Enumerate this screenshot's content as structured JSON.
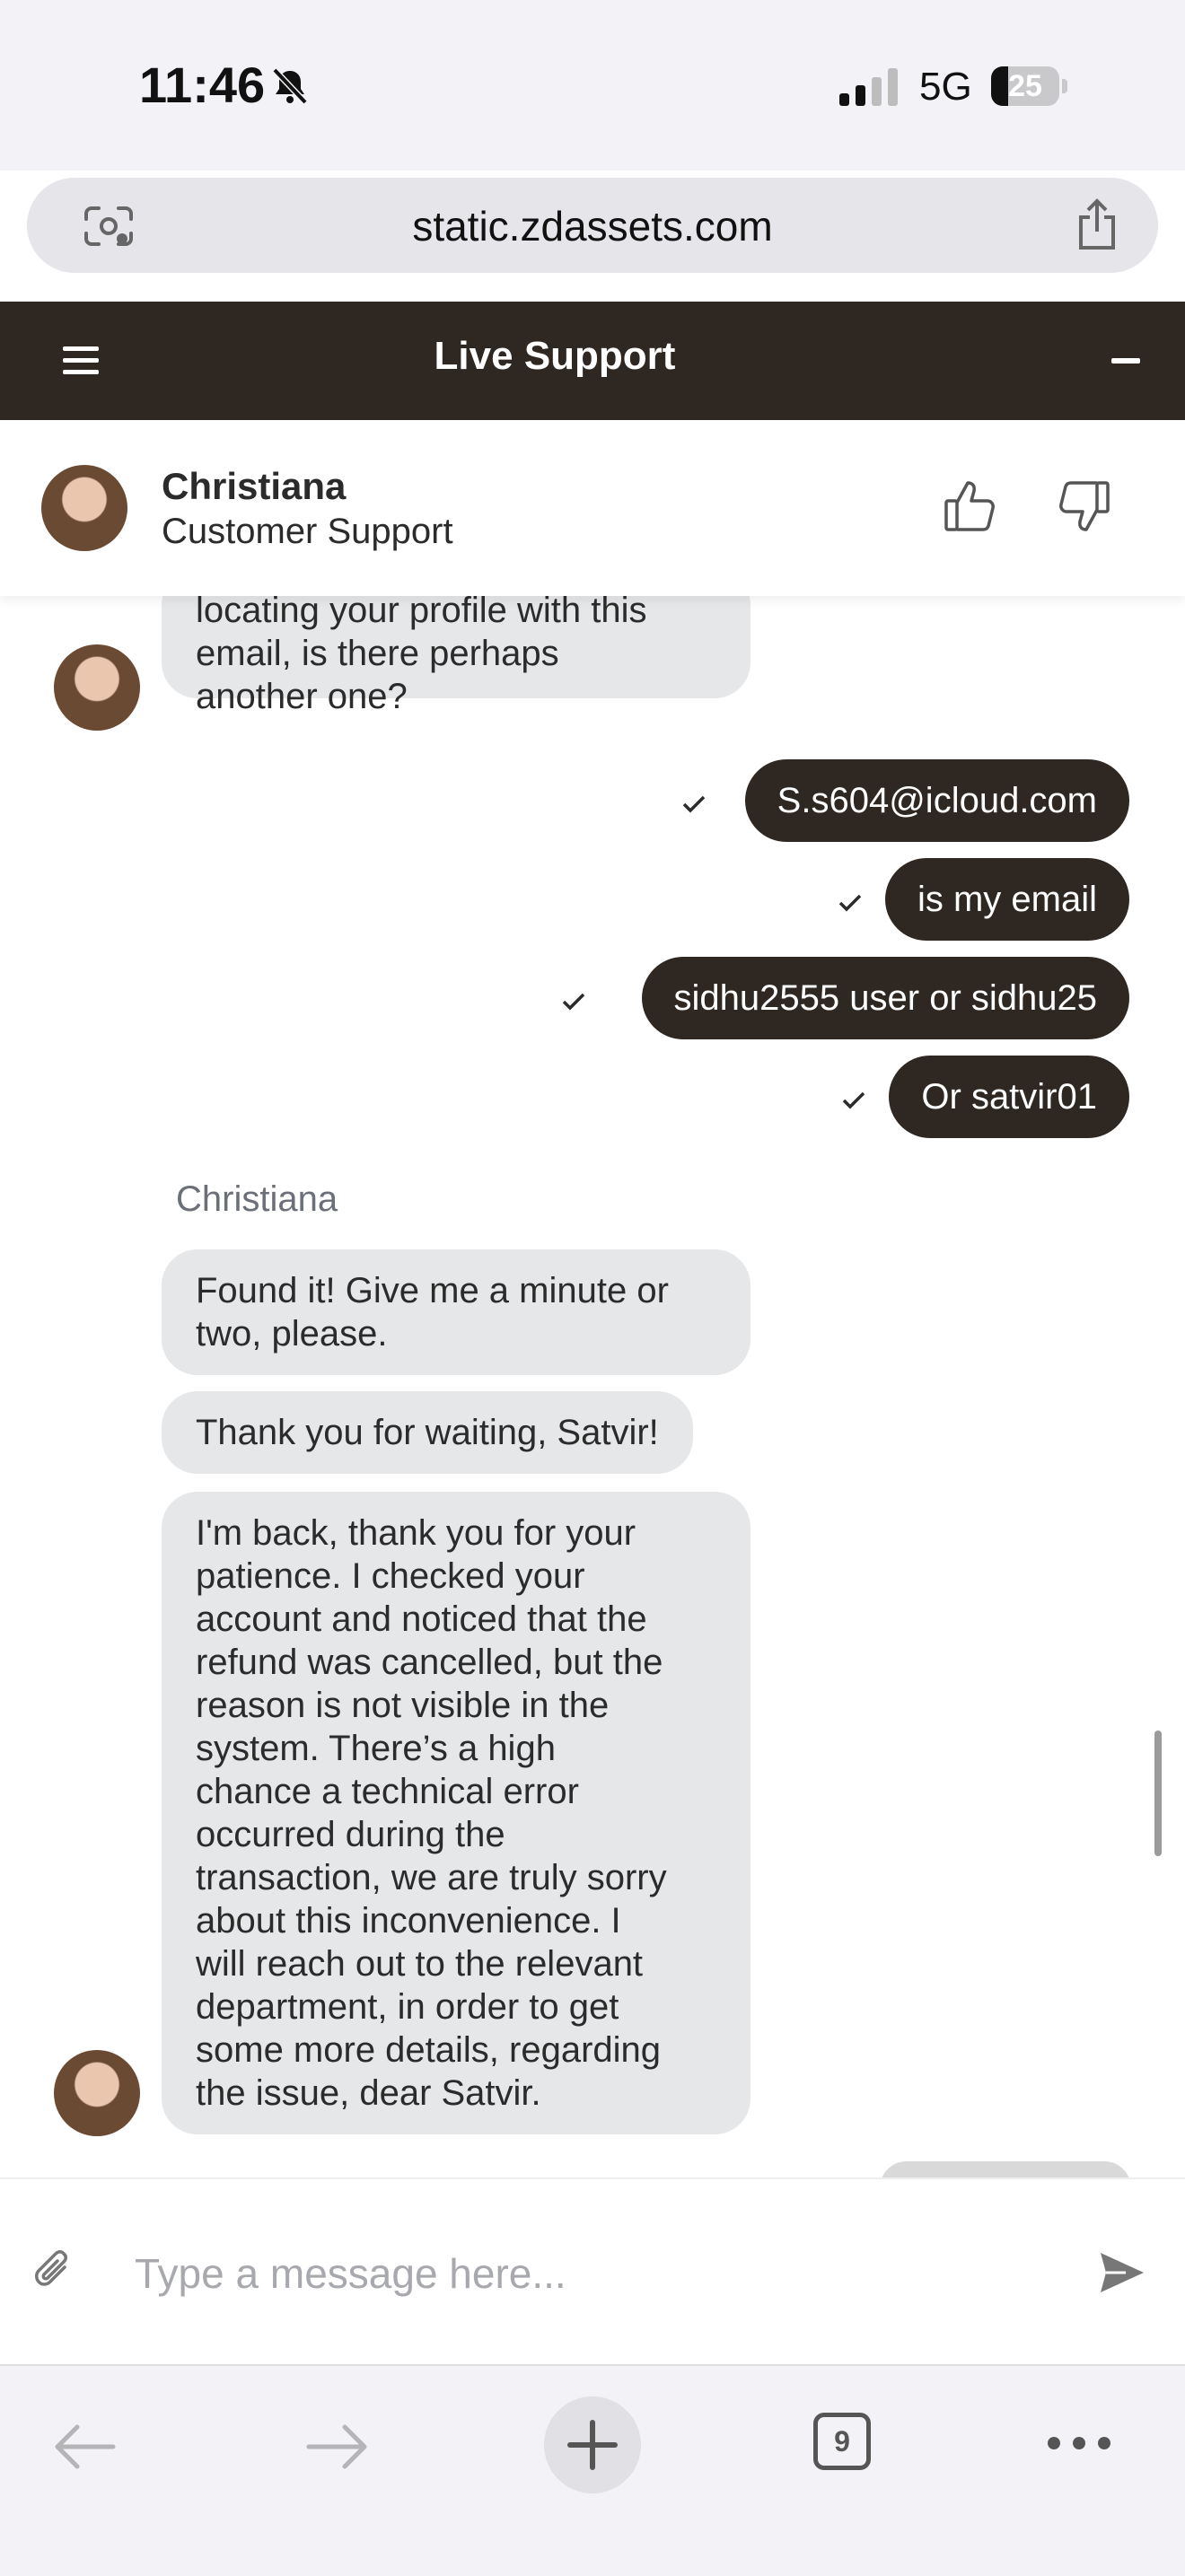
{
  "status_bar": {
    "time": "11:46",
    "network": "5G",
    "battery": "25",
    "battery_level": 0.25
  },
  "url_bar": {
    "url": "static.zdassets.com"
  },
  "header": {
    "title": "Live Support"
  },
  "agent": {
    "name": "Christiana",
    "role": "Customer Support"
  },
  "messages": {
    "m1": "locating your profile with this\nemail, is there perhaps\nanother one?",
    "m2": "S.s604@icloud.com",
    "m3": "is my email",
    "m4": "sidhu2555 user or sidhu25",
    "m5": "Or satvir01",
    "sender": "Christiana",
    "m6": "Found it! Give me a minute or\ntwo, please.",
    "m7": "Thank you for waiting, Satvir!",
    "m8": "I'm back, thank you for your\npatience. I checked your\naccount and noticed that the\nrefund was cancelled, but the\nreason is not visible in the\nsystem. There’s a high\nchance a technical error\noccurred during the\ntransaction, we are truly sorry\nabout this inconvenience. I\nwill reach out to the relevant\ndepartment, in order to get\nsome more details, regarding\nthe issue, dear Satvir."
  },
  "composer": {
    "placeholder": "Type a message here..."
  },
  "browser_nav": {
    "tab_count": "9"
  }
}
